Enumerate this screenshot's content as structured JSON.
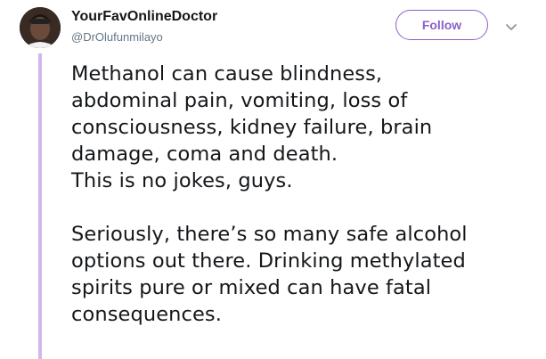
{
  "author": {
    "display_name": "YourFavOnlineDoctor",
    "handle": "@DrOlufunmilayo"
  },
  "actions": {
    "follow_label": "Follow",
    "more_icon": "chevron-down-icon"
  },
  "colors": {
    "accent": "#8a61c9",
    "thread_line": "#d3b7ea",
    "text": "#14171a",
    "muted": "#657786"
  },
  "tweet": {
    "paragraph_1": [
      "Methanol can cause blindness,",
      "abdominal pain, vomiting, loss of",
      "consciousness, kidney failure, brain",
      "damage, coma and death.",
      "This is no jokes, guys."
    ],
    "paragraph_2": [
      "Seriously, there’s so many safe alcohol",
      "options out there. Drinking methylated",
      "spirits pure or mixed can have fatal",
      "consequences."
    ]
  }
}
